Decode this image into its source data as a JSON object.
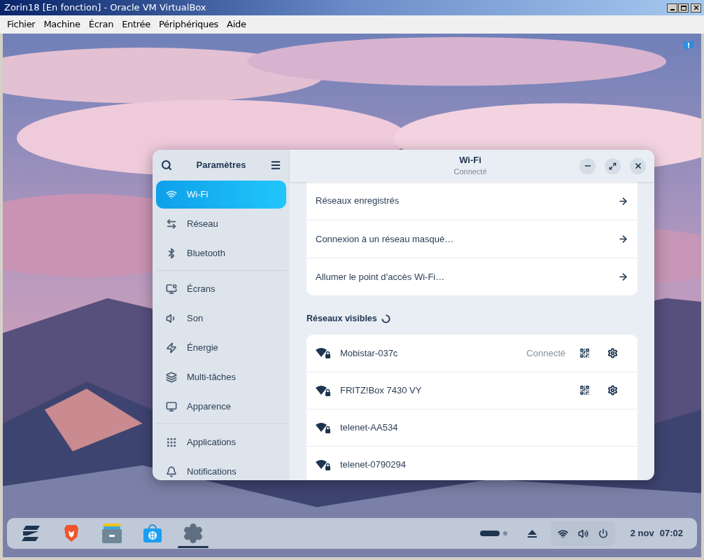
{
  "vm_window": {
    "title": "Zorin18 [En fonction] - Oracle VM VirtualBox",
    "menu": [
      "Fichier",
      "Machine",
      "Écran",
      "Entrée",
      "Périphériques",
      "Aide"
    ]
  },
  "settings": {
    "sidebar": {
      "title": "Paramètres",
      "groups": [
        [
          {
            "label": "Wi-Fi",
            "selected": true
          },
          {
            "label": "Réseau",
            "selected": false
          },
          {
            "label": "Bluetooth",
            "selected": false
          }
        ],
        [
          {
            "label": "Écrans",
            "selected": false
          },
          {
            "label": "Son",
            "selected": false
          },
          {
            "label": "Énergie",
            "selected": false
          },
          {
            "label": "Multi-tâches",
            "selected": false
          },
          {
            "label": "Apparence",
            "selected": false
          }
        ],
        [
          {
            "label": "Applications",
            "selected": false
          },
          {
            "label": "Notifications",
            "selected": false
          }
        ]
      ]
    },
    "header": {
      "title": "Wi-Fi",
      "subtitle": "Connecté"
    },
    "links": [
      "Réseaux enregistrés",
      "Connexion à un réseau masqué…",
      "Allumer le point d’accès Wi-Fi…"
    ],
    "visible_networks": {
      "title": "Réseaux visibles",
      "scanning": true,
      "networks": [
        {
          "name": "Mobistar-037c",
          "status": "Connecté",
          "actions": true
        },
        {
          "name": "FRITZ!Box 7430 VY",
          "actions": true
        },
        {
          "name": "telenet-AA534",
          "actions": false
        },
        {
          "name": "telenet-0790294",
          "actions": false
        }
      ]
    }
  },
  "taskbar": {
    "apps": [
      {
        "selected": false
      },
      {
        "selected": false
      },
      {
        "selected": false
      },
      {
        "selected": false
      },
      {
        "selected": true
      }
    ],
    "date": "2 nov",
    "time": "07:02"
  }
}
